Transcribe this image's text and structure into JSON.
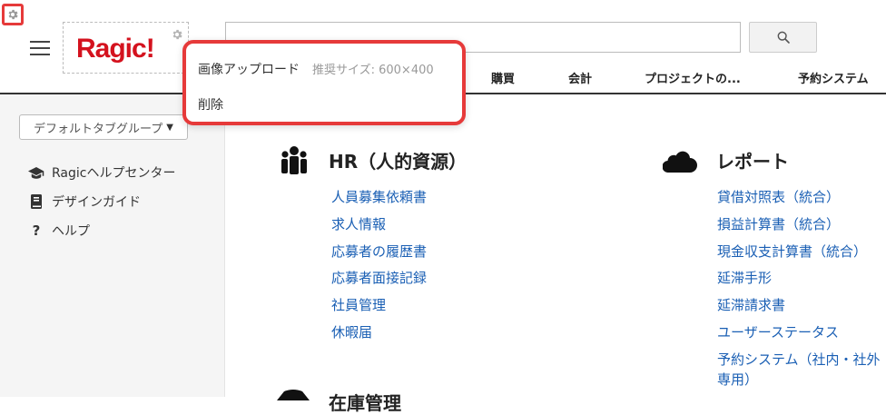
{
  "header": {
    "logo_text": "Ragic!",
    "search": {
      "value": "",
      "placeholder": ""
    },
    "tabs": [
      {
        "label": "購買"
      },
      {
        "label": "会計"
      },
      {
        "label": "プロジェクトの..."
      },
      {
        "label": "予約システム"
      }
    ]
  },
  "image_menu": {
    "upload_label": "画像アップロード",
    "size_hint": "推奨サイズ: 600×400",
    "delete_label": "削除"
  },
  "sidebar": {
    "tab_group": "デフォルトタブグループ",
    "links": [
      {
        "label": "Ragicヘルプセンター",
        "icon": "graduation-cap-icon"
      },
      {
        "label": "デザインガイド",
        "icon": "book-icon"
      },
      {
        "label": "ヘルプ",
        "icon": "question-icon"
      }
    ]
  },
  "sections": {
    "hr": {
      "title": "HR（人的資源）",
      "icon": "people-icon",
      "links": [
        "人員募集依頼書",
        "求人情報",
        "応募者の履歴書",
        "応募者面接記録",
        "社員管理",
        "休暇届"
      ]
    },
    "report": {
      "title": "レポート",
      "icon": "cloud-icon",
      "links": [
        "貸借対照表（統合）",
        "損益計算書（統合）",
        "現金収支計算書（統合）",
        "延滞手形",
        "延滞請求書",
        "ユーザーステータス",
        "予約システム（社内・社外",
        "専用）"
      ]
    },
    "third": {
      "title": "在庫管理",
      "icon": "box-icon"
    }
  },
  "colors": {
    "logo": "#d4121e",
    "highlight": "#e63a3a",
    "link": "#1a5fb4"
  }
}
